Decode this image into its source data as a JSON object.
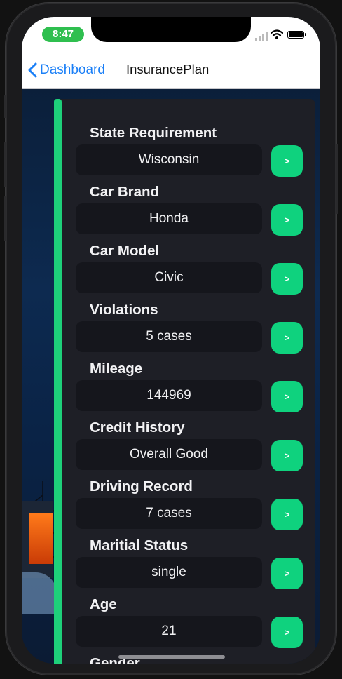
{
  "status_bar": {
    "time": "8:47"
  },
  "nav": {
    "back_label": "Dashboard",
    "title": "InsurancePlan"
  },
  "fields": [
    {
      "label": "State Requirement",
      "value": "Wisconsin",
      "button": ">"
    },
    {
      "label": "Car Brand",
      "value": "Honda",
      "button": ">"
    },
    {
      "label": "Car Model",
      "value": "Civic",
      "button": ">"
    },
    {
      "label": "Violations",
      "value": "5 cases",
      "button": ">"
    },
    {
      "label": "Mileage",
      "value": "144969",
      "button": ">"
    },
    {
      "label": "Credit History",
      "value": "Overall Good",
      "button": ">"
    },
    {
      "label": "Driving Record",
      "value": "7 cases",
      "button": ">"
    },
    {
      "label": "Maritial Status",
      "value": "single",
      "button": ">"
    },
    {
      "label": "Age",
      "value": "21",
      "button": ">"
    },
    {
      "label": "Gender"
    }
  ],
  "colors": {
    "accent": "#1ed07a",
    "button": "#0fd27e",
    "panel": "#1e1f26",
    "link": "#1a7ff7"
  }
}
